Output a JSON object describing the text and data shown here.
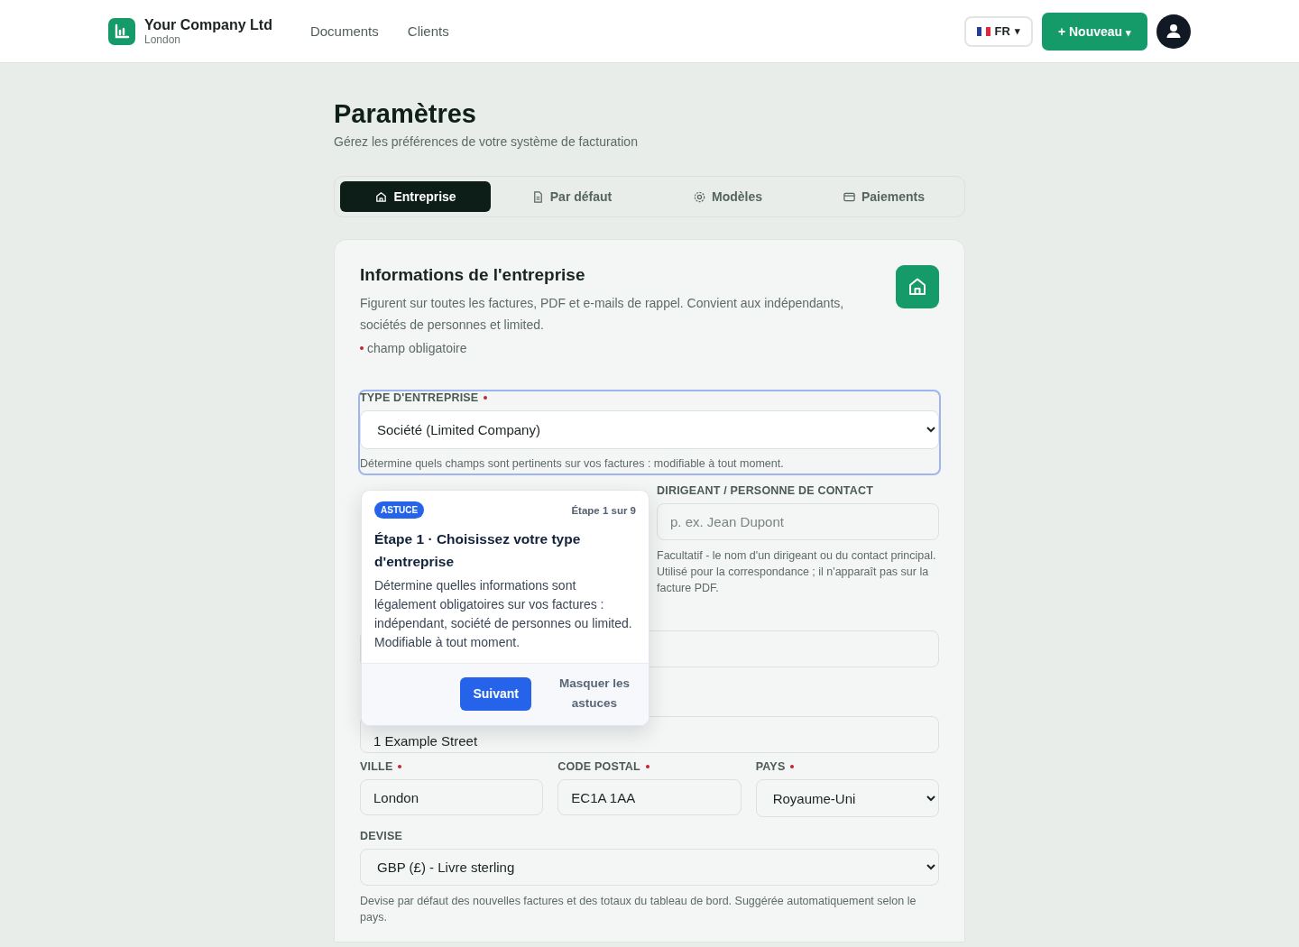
{
  "header": {
    "company": "Your Company Ltd",
    "city": "London",
    "nav": [
      {
        "label": "Documents"
      },
      {
        "label": "Clients"
      }
    ],
    "language": {
      "code": "FR",
      "caret": "▾"
    },
    "new_button": {
      "label": "+ Nouveau",
      "caret": "▾"
    }
  },
  "page": {
    "title": "Paramètres",
    "subtitle": "Gérez les préférences de votre système de facturation"
  },
  "tabs": [
    {
      "label": "Entreprise",
      "selected": true
    },
    {
      "label": "Par défaut",
      "selected": false
    },
    {
      "label": "Modèles",
      "selected": false
    },
    {
      "label": "Paiements",
      "selected": false
    }
  ],
  "card": {
    "title": "Informations de l'entreprise",
    "description": "Figurent sur toutes les factures, PDF et e-mails de rappel. Convient aux indépendants, sociétés de personnes et limited.",
    "required_note": "champ obligatoire"
  },
  "business_type": {
    "label": "TYPE D'ENTREPRISE",
    "required": true,
    "focused": true,
    "value": "Société (Limited Company)",
    "help": "Détermine quels champs sont pertinents sur vos factures : modifiable à tout moment."
  },
  "contact": {
    "label": "DIRIGEANT / PERSONNE DE CONTACT",
    "required": false,
    "placeholder": "p. ex. Jean Dupont",
    "help": "Facultatif - le nom d'un dirigeant ou du contact principal. Utilisé pour la correspondance ; il n'apparaît pas sur la facture PDF."
  },
  "address": {
    "value": "1 Example Street"
  },
  "location": [
    {
      "kind": "input",
      "label": "VILLE",
      "required": true,
      "value": "London"
    },
    {
      "kind": "input",
      "label": "CODE POSTAL",
      "required": true,
      "value": "EC1A 1AA"
    },
    {
      "kind": "select",
      "label": "PAYS",
      "required": true,
      "value": "Royaume-Uni"
    }
  ],
  "currency": {
    "label": "DEVISE",
    "required": false,
    "value": "GBP (£) - Livre sterling",
    "help": "Devise par défaut des nouvelles factures et des totaux du tableau de bord. Suggérée automatiquement selon le pays."
  },
  "tip": {
    "badge": "ASTUCE",
    "step": "Étape 1 sur 9",
    "title": "Étape 1 · Choisissez votre type d'entreprise",
    "body": "Détermine quelles informations sont légalement obligatoires sur vos factures : indépendant, société de personnes ou limited. Modifiable à tout moment.",
    "next": "Suivant",
    "hide": "Masquer les astuces"
  }
}
